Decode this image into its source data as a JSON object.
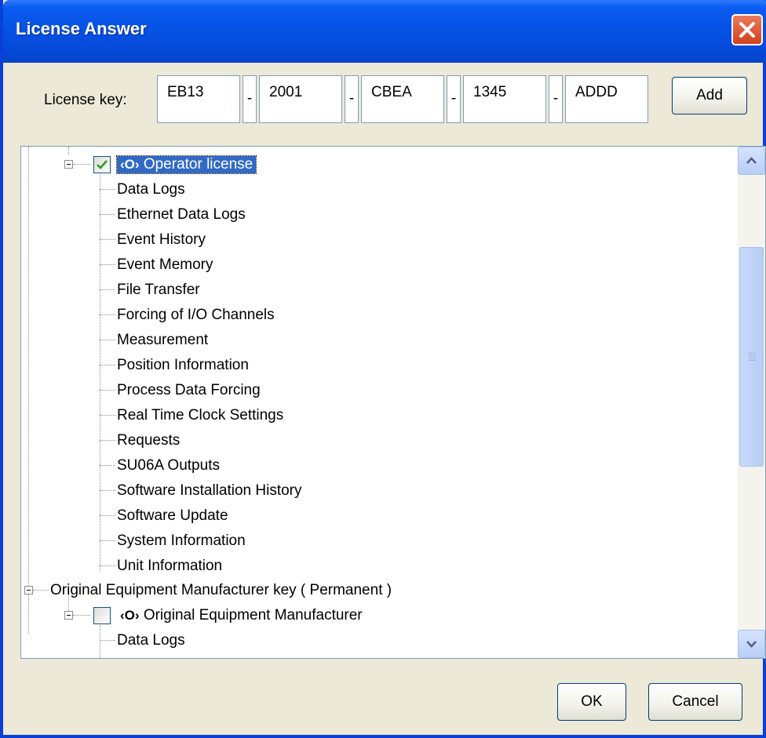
{
  "window": {
    "title": "License Answer"
  },
  "license": {
    "label": "License key:",
    "parts": [
      "EB13",
      "2001",
      "CBEA",
      "1345",
      "ADDD"
    ],
    "separator": "-",
    "add_label": "Add"
  },
  "tree": {
    "operator_node": {
      "label": "Operator license",
      "checked": true,
      "icon": "eye-icon"
    },
    "operator_items": [
      "Data Logs",
      "Ethernet Data Logs",
      "Event History",
      "Event Memory",
      "File Transfer",
      "Forcing of I/O Channels",
      "Measurement",
      "Position Information",
      "Process Data Forcing",
      "Real Time Clock Settings",
      "Requests",
      "SU06A Outputs",
      "Software Installation History",
      "Software Update",
      "System Information",
      "Unit Information"
    ],
    "oem_group": {
      "label": "Original Equipment Manufacturer key ( Permanent )"
    },
    "oem_node": {
      "label": "Original Equipment Manufacturer",
      "checked": false,
      "icon": "eye-icon"
    },
    "oem_items": [
      "Data Logs"
    ]
  },
  "footer": {
    "ok_label": "OK",
    "cancel_label": "Cancel"
  }
}
